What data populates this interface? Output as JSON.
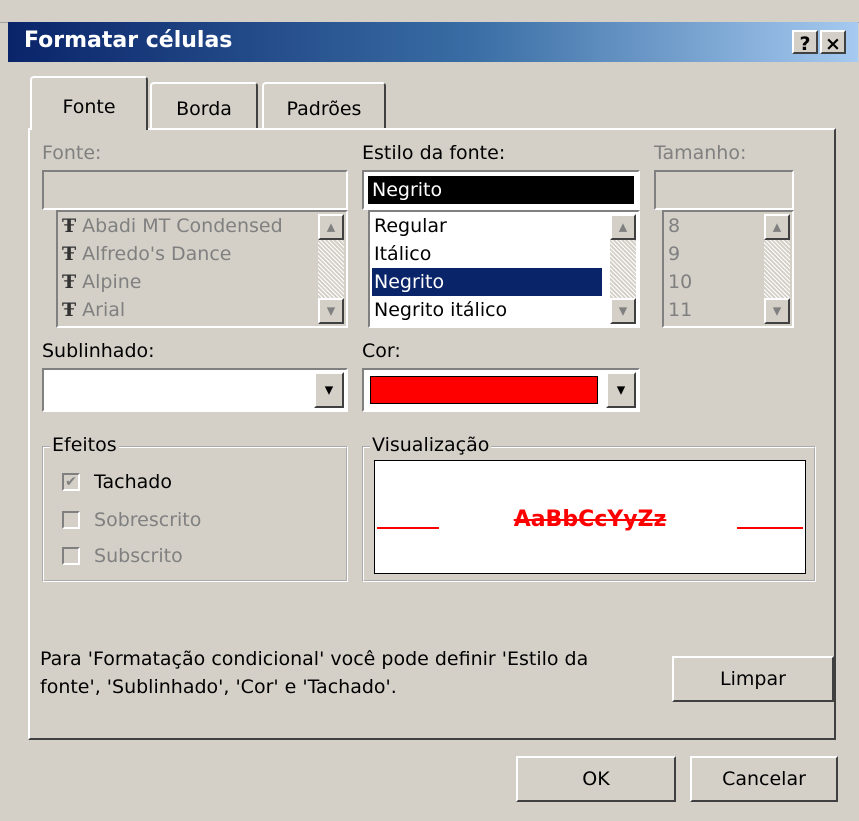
{
  "window": {
    "title": "Formatar células",
    "help_glyph": "?",
    "close_glyph": "×"
  },
  "tabs": [
    "Fonte",
    "Borda",
    "Padrões"
  ],
  "font": {
    "label": "Fonte:",
    "value": "",
    "items": [
      "Abadi MT Condensed",
      "Alfredo's Dance",
      "Alpine",
      "Arial"
    ],
    "item_icon": "truetype-font-icon"
  },
  "style": {
    "label": "Estilo da fonte:",
    "value": "Negrito",
    "items": [
      "Regular",
      "Itálico",
      "Negrito",
      "Negrito itálico"
    ],
    "selected_index": 2
  },
  "size": {
    "label": "Tamanho:",
    "value": "",
    "items": [
      "8",
      "9",
      "10",
      "11"
    ]
  },
  "underline": {
    "label": "Sublinhado:",
    "value": ""
  },
  "color": {
    "label": "Cor:",
    "swatch": "#ff0000"
  },
  "effects": {
    "title": "Efeitos",
    "strikethrough": {
      "label": "Tachado",
      "checked": true
    },
    "superscript": {
      "label": "Sobrescrito",
      "checked": false
    },
    "subscript": {
      "label": "Subscrito",
      "checked": false
    }
  },
  "preview": {
    "title": "Visualização",
    "sample": "AaBbCcYyZz",
    "color": "#ff0000"
  },
  "info_text_1": "Para 'Formatação condicional' você pode definir 'Estilo da",
  "info_text_2": "fonte', 'Sublinhado', 'Cor' e 'Tachado'.",
  "buttons": {
    "clear": "Limpar",
    "ok": "OK",
    "cancel": "Cancelar"
  },
  "colors": {
    "titlebar_start": "#0a246a",
    "titlebar_end": "#a6caf0",
    "selection": "#0a246a",
    "face": "#d4d0c8"
  }
}
